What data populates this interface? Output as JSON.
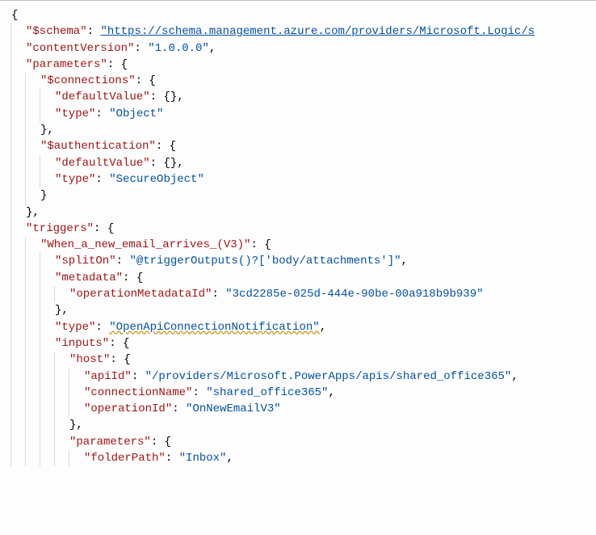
{
  "lines": [
    {
      "indent": 0,
      "segments": [
        {
          "cls": "punct",
          "txt": "{"
        }
      ]
    },
    {
      "indent": 1,
      "segments": [
        {
          "cls": "key",
          "txt": "\"$schema\""
        },
        {
          "cls": "punct",
          "txt": ": "
        },
        {
          "cls": "link",
          "txt": "\"https://schema.management.azure.com/providers/Microsoft.Logic/s"
        }
      ]
    },
    {
      "indent": 1,
      "segments": [
        {
          "cls": "key",
          "txt": "\"contentVersion\""
        },
        {
          "cls": "punct",
          "txt": ": "
        },
        {
          "cls": "str",
          "txt": "\"1.0.0.0\""
        },
        {
          "cls": "punct",
          "txt": ","
        }
      ]
    },
    {
      "indent": 1,
      "segments": [
        {
          "cls": "key",
          "txt": "\"parameters\""
        },
        {
          "cls": "punct",
          "txt": ": {"
        }
      ]
    },
    {
      "indent": 2,
      "segments": [
        {
          "cls": "key",
          "txt": "\"$connections\""
        },
        {
          "cls": "punct",
          "txt": ": {"
        }
      ]
    },
    {
      "indent": 3,
      "segments": [
        {
          "cls": "key",
          "txt": "\"defaultValue\""
        },
        {
          "cls": "punct",
          "txt": ": {},"
        }
      ]
    },
    {
      "indent": 3,
      "segments": [
        {
          "cls": "key",
          "txt": "\"type\""
        },
        {
          "cls": "punct",
          "txt": ": "
        },
        {
          "cls": "str",
          "txt": "\"Object\""
        }
      ]
    },
    {
      "indent": 2,
      "segments": [
        {
          "cls": "punct",
          "txt": "},"
        }
      ]
    },
    {
      "indent": 2,
      "segments": [
        {
          "cls": "key",
          "txt": "\"$authentication\""
        },
        {
          "cls": "punct",
          "txt": ": {"
        }
      ]
    },
    {
      "indent": 3,
      "segments": [
        {
          "cls": "key",
          "txt": "\"defaultValue\""
        },
        {
          "cls": "punct",
          "txt": ": {},"
        }
      ]
    },
    {
      "indent": 3,
      "segments": [
        {
          "cls": "key",
          "txt": "\"type\""
        },
        {
          "cls": "punct",
          "txt": ": "
        },
        {
          "cls": "str",
          "txt": "\"SecureObject\""
        }
      ]
    },
    {
      "indent": 2,
      "segments": [
        {
          "cls": "punct",
          "txt": "}"
        }
      ]
    },
    {
      "indent": 1,
      "segments": [
        {
          "cls": "punct",
          "txt": "},"
        }
      ]
    },
    {
      "indent": 1,
      "segments": [
        {
          "cls": "key",
          "txt": "\"triggers\""
        },
        {
          "cls": "punct",
          "txt": ": {"
        }
      ]
    },
    {
      "indent": 2,
      "segments": [
        {
          "cls": "key",
          "txt": "\"When_a_new_email_arrives_(V3)\""
        },
        {
          "cls": "punct",
          "txt": ": {"
        }
      ]
    },
    {
      "indent": 3,
      "segments": [
        {
          "cls": "key",
          "txt": "\"splitOn\""
        },
        {
          "cls": "punct",
          "txt": ": "
        },
        {
          "cls": "str",
          "txt": "\"@triggerOutputs()?['body/attachments']\""
        },
        {
          "cls": "punct",
          "txt": ","
        }
      ]
    },
    {
      "indent": 3,
      "segments": [
        {
          "cls": "key",
          "txt": "\"metadata\""
        },
        {
          "cls": "punct",
          "txt": ": {"
        }
      ]
    },
    {
      "indent": 4,
      "segments": [
        {
          "cls": "key",
          "txt": "\"operationMetadataId\""
        },
        {
          "cls": "punct",
          "txt": ": "
        },
        {
          "cls": "str",
          "txt": "\"3cd2285e-025d-444e-90be-00a918b9b939\""
        }
      ]
    },
    {
      "indent": 3,
      "segments": [
        {
          "cls": "punct",
          "txt": "},"
        }
      ]
    },
    {
      "indent": 3,
      "segments": [
        {
          "cls": "key",
          "txt": "\"type\""
        },
        {
          "cls": "punct",
          "txt": ": "
        },
        {
          "cls": "str warn-underline",
          "txt": "\"OpenApiConnectionNotification\""
        },
        {
          "cls": "punct",
          "txt": ","
        }
      ]
    },
    {
      "indent": 3,
      "segments": [
        {
          "cls": "key",
          "txt": "\"inputs\""
        },
        {
          "cls": "punct",
          "txt": ": {"
        }
      ]
    },
    {
      "indent": 4,
      "segments": [
        {
          "cls": "key",
          "txt": "\"host\""
        },
        {
          "cls": "punct",
          "txt": ": {"
        }
      ]
    },
    {
      "indent": 5,
      "segments": [
        {
          "cls": "key",
          "txt": "\"apiId\""
        },
        {
          "cls": "punct",
          "txt": ": "
        },
        {
          "cls": "str",
          "txt": "\"/providers/Microsoft.PowerApps/apis/shared_office365\""
        },
        {
          "cls": "punct",
          "txt": ","
        }
      ]
    },
    {
      "indent": 5,
      "segments": [
        {
          "cls": "key",
          "txt": "\"connectionName\""
        },
        {
          "cls": "punct",
          "txt": ": "
        },
        {
          "cls": "str",
          "txt": "\"shared_office365\""
        },
        {
          "cls": "punct",
          "txt": ","
        }
      ]
    },
    {
      "indent": 5,
      "segments": [
        {
          "cls": "key",
          "txt": "\"operationId\""
        },
        {
          "cls": "punct",
          "txt": ": "
        },
        {
          "cls": "str",
          "txt": "\"OnNewEmailV3\""
        }
      ]
    },
    {
      "indent": 4,
      "segments": [
        {
          "cls": "punct",
          "txt": "},"
        }
      ]
    },
    {
      "indent": 4,
      "segments": [
        {
          "cls": "key",
          "txt": "\"parameters\""
        },
        {
          "cls": "punct",
          "txt": ": {"
        }
      ]
    },
    {
      "indent": 5,
      "segments": [
        {
          "cls": "key",
          "txt": "\"folderPath\""
        },
        {
          "cls": "punct",
          "txt": ": "
        },
        {
          "cls": "str",
          "txt": "\"Inbox\""
        },
        {
          "cls": "punct",
          "txt": ","
        }
      ]
    }
  ]
}
